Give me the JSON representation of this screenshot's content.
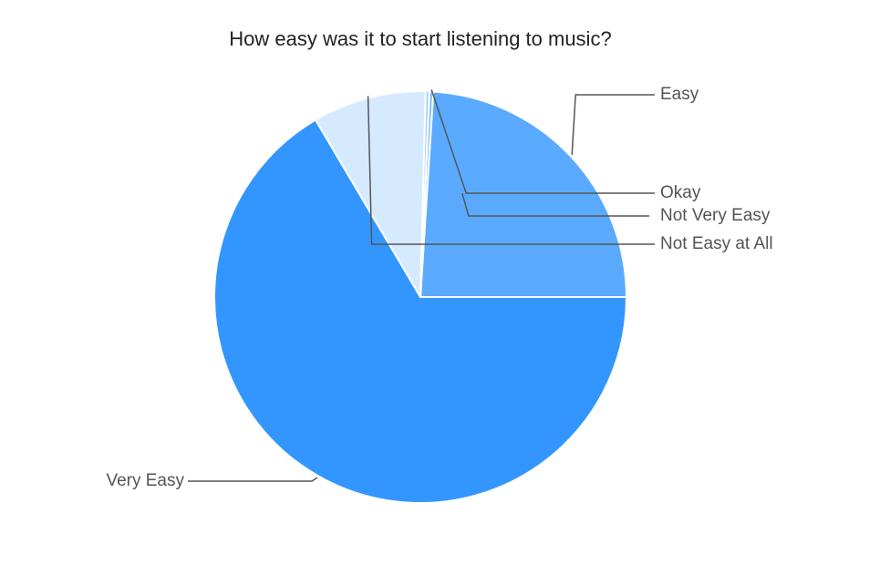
{
  "chart_data": {
    "type": "pie",
    "title": "How easy was it to start listening to music?",
    "slices": [
      {
        "label": "Easy",
        "value": 24,
        "color": "#5aaaff"
      },
      {
        "label": "Okay",
        "value": 0.3,
        "color": "#7ebcff"
      },
      {
        "label": "Not Very Easy",
        "value": 0.3,
        "color": "#a8d2ff"
      },
      {
        "label": "Not Easy at All",
        "value": 8.9,
        "color": "#d6eaff"
      },
      {
        "label": "Very Easy",
        "value": 66.5,
        "color": "#3396ff"
      }
    ],
    "legend": "none",
    "labels": "outside with leader lines"
  }
}
